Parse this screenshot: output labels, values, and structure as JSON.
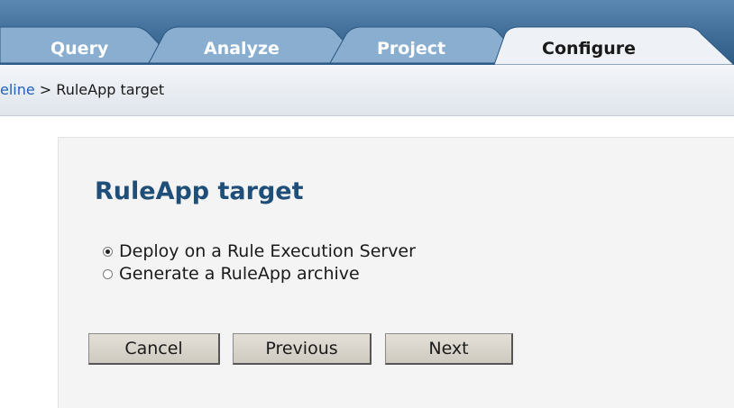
{
  "tabs": [
    {
      "label": "Query",
      "active": false
    },
    {
      "label": "Analyze",
      "active": false
    },
    {
      "label": "Project",
      "active": false
    },
    {
      "label": "Configure",
      "active": true
    }
  ],
  "breadcrumb": {
    "link_text": "eline",
    "separator": " > ",
    "current": "RuleApp target"
  },
  "main": {
    "title": "RuleApp target",
    "options": [
      {
        "label": "Deploy on a Rule Execution Server",
        "selected": true
      },
      {
        "label": "Generate a RuleApp archive",
        "selected": false
      }
    ],
    "buttons": {
      "cancel": "Cancel",
      "previous": "Previous",
      "next": "Next"
    }
  },
  "colors": {
    "tab_band": "#3f6d98",
    "active_tab": "#eef2f6",
    "title": "#1f4e79",
    "link": "#1f62b8"
  }
}
